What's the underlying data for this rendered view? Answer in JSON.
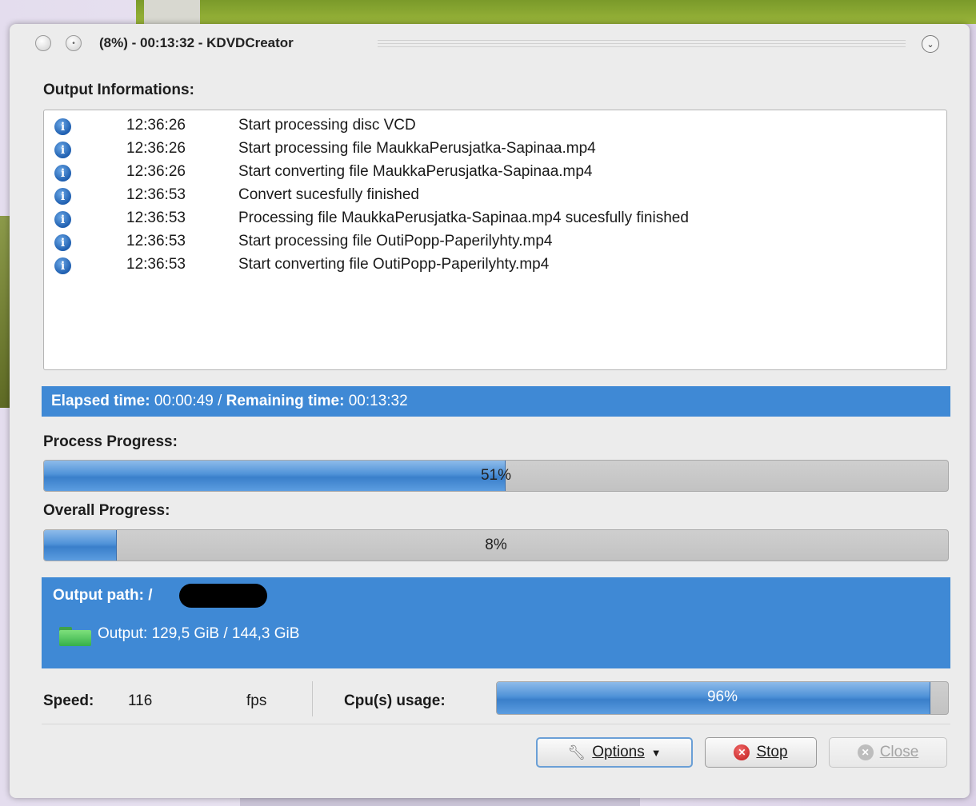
{
  "window": {
    "title": "(8%) - 00:13:32 - KDVDCreator"
  },
  "log": {
    "heading": "Output Informations:",
    "rows": [
      {
        "time": "12:36:26",
        "message": "Start processing disc VCD"
      },
      {
        "time": "12:36:26",
        "message": "Start processing file MaukkaPerusjatka-Sapinaa.mp4"
      },
      {
        "time": "12:36:26",
        "message": "Start converting file MaukkaPerusjatka-Sapinaa.mp4"
      },
      {
        "time": "12:36:53",
        "message": "Convert sucesfully finished"
      },
      {
        "time": "12:36:53",
        "message": "Processing file MaukkaPerusjatka-Sapinaa.mp4 sucesfully finished"
      },
      {
        "time": "12:36:53",
        "message": "Start processing file OutiPopp-Paperilyhty.mp4"
      },
      {
        "time": "12:36:53",
        "message": "Start converting file OutiPopp-Paperilyhty.mp4"
      }
    ]
  },
  "timing": {
    "elapsed_label": "Elapsed time:",
    "elapsed_value": "00:00:49",
    "separator": "/",
    "remaining_label": "Remaining time:",
    "remaining_value": "00:13:32"
  },
  "process_progress": {
    "label": "Process Progress:",
    "percent": 51,
    "text": "51%"
  },
  "overall_progress": {
    "label": "Overall Progress:",
    "percent": 8,
    "text": "8%"
  },
  "output": {
    "path_label": "Output path: /",
    "disk_text": "Output: 129,5 GiB / 144,3 GiB"
  },
  "stats": {
    "speed_label": "Speed:",
    "speed_value": "116",
    "speed_unit": "fps",
    "cpu_label": "Cpu(s) usage:",
    "cpu_percent": 96,
    "cpu_text": "96%"
  },
  "buttons": {
    "options": "Options",
    "stop": "Stop",
    "close": "Close"
  },
  "colors": {
    "accent": "#3f89d5",
    "stop": "#c01818"
  }
}
